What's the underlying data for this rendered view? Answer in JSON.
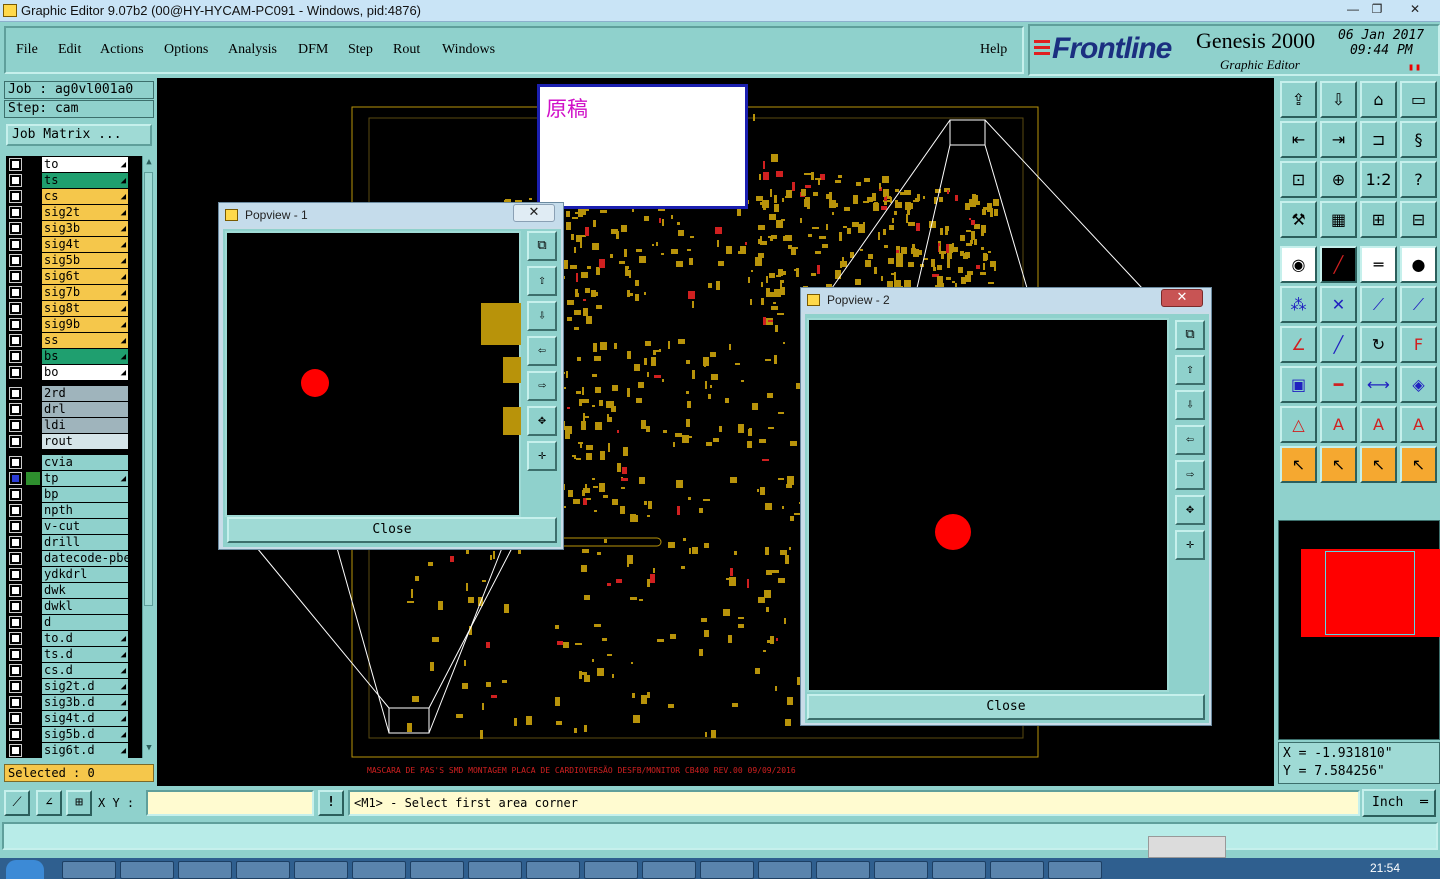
{
  "window": {
    "title": "Graphic Editor 9.07b2 (00@HY-HYCAM-PC091 - Windows, pid:4876)",
    "min": "—",
    "restore": "❐",
    "close": "✕"
  },
  "menu": {
    "items": [
      "File",
      "Edit",
      "Actions",
      "Options",
      "Analysis",
      "DFM",
      "Step",
      "Rout",
      "Windows"
    ],
    "help": "Help"
  },
  "brand": {
    "logo": "Frontline",
    "product": "Genesis 2000",
    "subtitle": "Graphic Editor",
    "date": "06 Jan 2017",
    "time": "09:44 PM"
  },
  "job": {
    "job_label": "Job : ag0vl001a0",
    "step_label": "Step: cam",
    "job_matrix": "Job Matrix ..."
  },
  "layers": [
    {
      "name": "to",
      "color": "#ffffff",
      "arrow": true
    },
    {
      "name": "ts",
      "color": "#1f9f6f",
      "arrow": true
    },
    {
      "name": "cs",
      "color": "#f5c74b",
      "arrow": true
    },
    {
      "name": "sig2t",
      "color": "#f5c74b",
      "arrow": true
    },
    {
      "name": "sig3b",
      "color": "#f5c74b",
      "arrow": true
    },
    {
      "name": "sig4t",
      "color": "#f5c74b",
      "arrow": true
    },
    {
      "name": "sig5b",
      "color": "#f5c74b",
      "arrow": true
    },
    {
      "name": "sig6t",
      "color": "#f5c74b",
      "arrow": true
    },
    {
      "name": "sig7b",
      "color": "#f5c74b",
      "arrow": true
    },
    {
      "name": "sig8t",
      "color": "#f5c74b",
      "arrow": true
    },
    {
      "name": "sig9b",
      "color": "#f5c74b",
      "arrow": true
    },
    {
      "name": "ss",
      "color": "#f5c74b",
      "arrow": true
    },
    {
      "name": "bs",
      "color": "#1f9f6f",
      "arrow": true
    },
    {
      "name": "bo",
      "color": "#ffffff",
      "arrow": true
    },
    {
      "name": "2rd",
      "color": "#9fb4bc",
      "arrow": false
    },
    {
      "name": "drl",
      "color": "#9fb4bc",
      "arrow": false
    },
    {
      "name": "ldi",
      "color": "#9fb4bc",
      "arrow": false
    },
    {
      "name": "rout",
      "color": "#d4e4e8",
      "arrow": false
    },
    {
      "name": "cvia",
      "color": "#8fd1cc",
      "arrow": false
    },
    {
      "name": "tp",
      "color": "#8fd1cc",
      "arrow": true
    },
    {
      "name": "bp",
      "color": "#8fd1cc",
      "arrow": false
    },
    {
      "name": "npth",
      "color": "#8fd1cc",
      "arrow": false
    },
    {
      "name": "v-cut",
      "color": "#8fd1cc",
      "arrow": false
    },
    {
      "name": "drill",
      "color": "#8fd1cc",
      "arrow": false
    },
    {
      "name": "datecode-pbe",
      "color": "#8fd1cc",
      "arrow": false
    },
    {
      "name": "ydkdrl",
      "color": "#8fd1cc",
      "arrow": false
    },
    {
      "name": "dwk",
      "color": "#8fd1cc",
      "arrow": false
    },
    {
      "name": "dwkl",
      "color": "#8fd1cc",
      "arrow": false
    },
    {
      "name": "d",
      "color": "#8fd1cc",
      "arrow": false
    },
    {
      "name": "to.d",
      "color": "#8fd1cc",
      "arrow": true
    },
    {
      "name": "ts.d",
      "color": "#8fd1cc",
      "arrow": true
    },
    {
      "name": "cs.d",
      "color": "#8fd1cc",
      "arrow": true
    },
    {
      "name": "sig2t.d",
      "color": "#8fd1cc",
      "arrow": true
    },
    {
      "name": "sig3b.d",
      "color": "#8fd1cc",
      "arrow": true
    },
    {
      "name": "sig4t.d",
      "color": "#8fd1cc",
      "arrow": true
    },
    {
      "name": "sig5b.d",
      "color": "#8fd1cc",
      "arrow": true
    },
    {
      "name": "sig6t.d",
      "color": "#8fd1cc",
      "arrow": true
    }
  ],
  "selected_label": "Selected : 0",
  "note": {
    "text": "原稿"
  },
  "popview1": {
    "title": "Popview - 1",
    "close_label": "Close",
    "close_x": "✕"
  },
  "popview2": {
    "title": "Popview - 2",
    "close_label": "Close",
    "close_x": "✕"
  },
  "board_caption": "MASCARA DE PAS'S SMD MONTAGEM PLACA DE CARDIOVERSÃO DESFB/MONITOR CB400 REV.00 09/09/2016",
  "coords": {
    "x": "X = -1.931810\"",
    "y": "Y = 7.584256\""
  },
  "bottom": {
    "xy_label": "X Y :",
    "xy_value": "",
    "alert": "!",
    "status": "<M1> - Select first area corner",
    "units": "Inch"
  },
  "taskbar": {
    "clock": "21:54"
  },
  "colors": {
    "accent": "#8fd1cc",
    "copper": "#b8930a",
    "highlight": "#ff0000",
    "note_border": "#1b1fb0",
    "note_text": "#d010c8"
  }
}
